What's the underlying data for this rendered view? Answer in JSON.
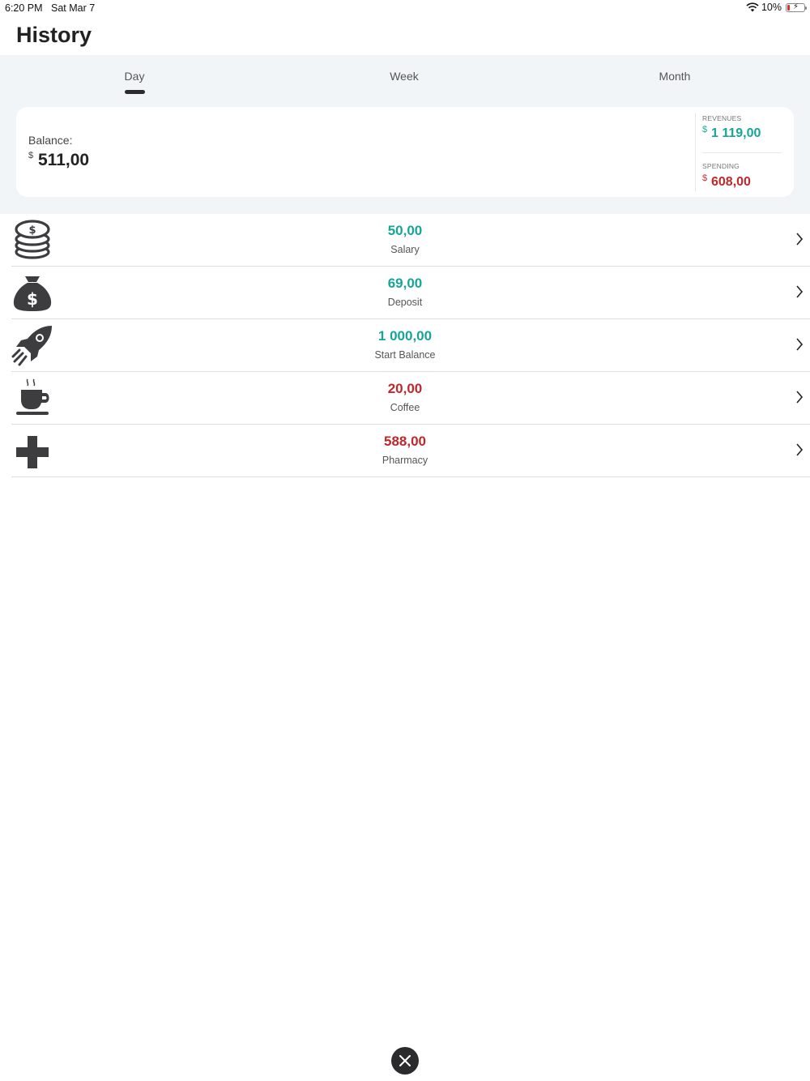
{
  "status_bar": {
    "time": "6:20 PM",
    "date": "Sat Mar 7",
    "battery": "10%"
  },
  "page_title": "History",
  "tabs": [
    {
      "label": "Day",
      "selected": true
    },
    {
      "label": "Week",
      "selected": false
    },
    {
      "label": "Month",
      "selected": false
    }
  ],
  "balance": {
    "label": "Balance:",
    "currency": "$",
    "value": "511,00",
    "revenues_label": "REVENUES",
    "revenues_currency": "$",
    "revenues_value": "1 119,00",
    "spending_label": "SPENDING",
    "spending_currency": "$",
    "spending_value": "608,00"
  },
  "colors": {
    "income": "#17a597",
    "expense": "#c0272d",
    "icon": "#3d3d40",
    "panel": "#f2f5f8"
  },
  "transactions": [
    {
      "amount": "50,00",
      "name": "Salary",
      "type": "income",
      "icon": "coins-stack-icon"
    },
    {
      "amount": "69,00",
      "name": "Deposit",
      "type": "income",
      "icon": "money-bag-icon"
    },
    {
      "amount": "1 000,00",
      "name": "Start Balance",
      "type": "income",
      "icon": "rocket-icon"
    },
    {
      "amount": "20,00",
      "name": "Coffee",
      "type": "expense",
      "icon": "coffee-cup-icon"
    },
    {
      "amount": "588,00",
      "name": "Pharmacy",
      "type": "expense",
      "icon": "medical-cross-icon"
    }
  ],
  "close_icon": "close-icon"
}
